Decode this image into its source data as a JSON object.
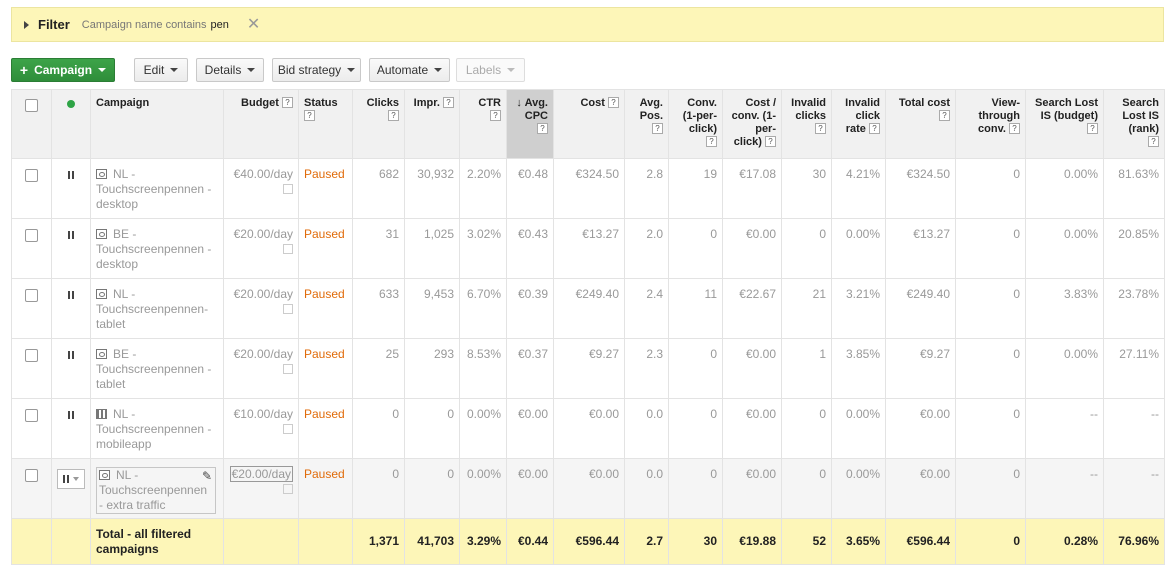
{
  "filter": {
    "title": "Filter",
    "desc": "Campaign name contains",
    "value": "pen",
    "close": "✕"
  },
  "toolbar": {
    "campaign": "Campaign",
    "edit": "Edit",
    "details": "Details",
    "bid_strategy": "Bid strategy",
    "automate": "Automate",
    "labels": "Labels"
  },
  "columns": {
    "campaign": "Campaign",
    "budget": "Budget",
    "status": "Status",
    "clicks": "Clicks",
    "impr": "Impr.",
    "ctr": "CTR",
    "avg_cpc": "Avg. CPC",
    "cost": "Cost",
    "avg_pos": "Avg. Pos.",
    "conv": "Conv. (1-per-click)",
    "cost_conv": "Cost / conv. (1-per-click)",
    "invalid_clicks": "Invalid clicks",
    "invalid_rate": "Invalid click rate",
    "total_cost": "Total cost",
    "view_through": "View-through conv.",
    "lost_budget": "Search Lost IS (budget)",
    "lost_rank": "Search Lost IS (rank)",
    "help": "?",
    "sort_arrow": "↓"
  },
  "rows": [
    {
      "name": "NL - Touchscreenpennen - desktop",
      "budget": "€40.00/day",
      "status": "Paused",
      "clicks": "682",
      "impr": "30,932",
      "ctr": "2.20%",
      "cpc": "€0.48",
      "cost": "€324.50",
      "pos": "2.8",
      "conv": "19",
      "cost_conv": "€17.08",
      "invalid": "30",
      "invalid_rate": "4.21%",
      "total_cost": "€324.50",
      "view": "0",
      "lost_budget": "0.00%",
      "lost_rank": "81.63%"
    },
    {
      "name": "BE - Touchscreenpennen - desktop",
      "budget": "€20.00/day",
      "status": "Paused",
      "clicks": "31",
      "impr": "1,025",
      "ctr": "3.02%",
      "cpc": "€0.43",
      "cost": "€13.27",
      "pos": "2.0",
      "conv": "0",
      "cost_conv": "€0.00",
      "invalid": "0",
      "invalid_rate": "0.00%",
      "total_cost": "€13.27",
      "view": "0",
      "lost_budget": "0.00%",
      "lost_rank": "20.85%"
    },
    {
      "name": "NL - Touchscreenpennen-tablet",
      "budget": "€20.00/day",
      "status": "Paused",
      "clicks": "633",
      "impr": "9,453",
      "ctr": "6.70%",
      "cpc": "€0.39",
      "cost": "€249.40",
      "pos": "2.4",
      "conv": "11",
      "cost_conv": "€22.67",
      "invalid": "21",
      "invalid_rate": "3.21%",
      "total_cost": "€249.40",
      "view": "0",
      "lost_budget": "3.83%",
      "lost_rank": "23.78%"
    },
    {
      "name": "BE - Touchscreenpennen - tablet",
      "budget": "€20.00/day",
      "status": "Paused",
      "clicks": "25",
      "impr": "293",
      "ctr": "8.53%",
      "cpc": "€0.37",
      "cost": "€9.27",
      "pos": "2.3",
      "conv": "0",
      "cost_conv": "€0.00",
      "invalid": "1",
      "invalid_rate": "3.85%",
      "total_cost": "€9.27",
      "view": "0",
      "lost_budget": "0.00%",
      "lost_rank": "27.11%"
    },
    {
      "name": "NL - Touchscreenpennen - mobileapp",
      "budget": "€10.00/day",
      "status": "Paused",
      "clicks": "0",
      "impr": "0",
      "ctr": "0.00%",
      "cpc": "€0.00",
      "cost": "€0.00",
      "pos": "0.0",
      "conv": "0",
      "cost_conv": "€0.00",
      "invalid": "0",
      "invalid_rate": "0.00%",
      "total_cost": "€0.00",
      "view": "0",
      "lost_budget": "--",
      "lost_rank": "--"
    },
    {
      "name": "NL - Touchscreenpennen - extra traffic",
      "budget": "€20.00/day",
      "status": "Paused",
      "clicks": "0",
      "impr": "0",
      "ctr": "0.00%",
      "cpc": "€0.00",
      "cost": "€0.00",
      "pos": "0.0",
      "conv": "0",
      "cost_conv": "€0.00",
      "invalid": "0",
      "invalid_rate": "0.00%",
      "total_cost": "€0.00",
      "view": "0",
      "lost_budget": "--",
      "lost_rank": "--"
    }
  ],
  "total": {
    "label": "Total - all filtered campaigns",
    "clicks": "1,371",
    "impr": "41,703",
    "ctr": "3.29%",
    "cpc": "€0.44",
    "cost": "€596.44",
    "pos": "2.7",
    "conv": "30",
    "cost_conv": "€19.88",
    "invalid": "52",
    "invalid_rate": "3.65%",
    "total_cost": "€596.44",
    "view": "0",
    "lost_budget": "0.28%",
    "lost_rank": "76.96%"
  },
  "colors": {
    "accent_green": "#2f8e3a",
    "status_paused": "#e06b0a",
    "filter_bg": "#fdf6b8"
  }
}
